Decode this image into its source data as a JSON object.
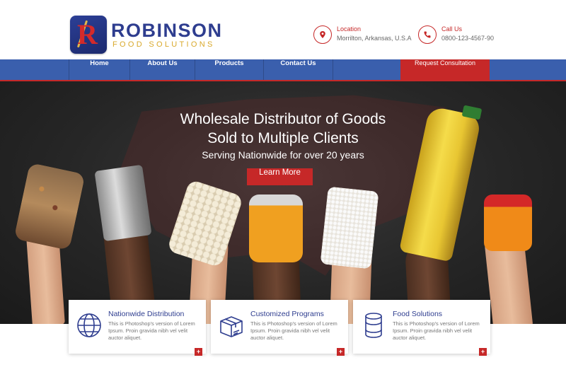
{
  "brand": {
    "name": "ROBINSON",
    "tagline": "FOOD SOLUTIONS",
    "logo_letter": "R"
  },
  "contacts": [
    {
      "label": "Location",
      "value": "Morrilton, Arkansas, U.S.A",
      "icon": "map-pin-icon"
    },
    {
      "label": "Call Us",
      "value": "0800-123-4567-90",
      "icon": "phone-icon"
    }
  ],
  "nav": {
    "items": [
      "Home",
      "About Us",
      "Products",
      "Contact Us"
    ],
    "cta": "Request Consultation"
  },
  "hero": {
    "title_line1": "Wholesale Distributor of Goods",
    "title_line2": "Sold to Multiple Clients",
    "tagline": "Serving Nationwide for over 20 years",
    "button": "Learn More"
  },
  "cards": [
    {
      "title": "Nationwide Distribution",
      "text": "This is Photoshop's version  of Lorem Ipsum. Proin gravida nibh vel velit auctor aliquet.",
      "icon": "globe-icon",
      "more": "+"
    },
    {
      "title": "Customized Programs",
      "text": "This is Photoshop's version  of Lorem Ipsum. Proin gravida nibh vel velit auctor aliquet.",
      "icon": "box-icon",
      "more": "+"
    },
    {
      "title": "Food Solutions",
      "text": "This is Photoshop's version  of Lorem Ipsum. Proin gravida nibh vel velit auctor aliquet.",
      "icon": "can-icon",
      "more": "+"
    }
  ],
  "colors": {
    "brand_blue": "#2e3d8f",
    "nav_blue": "#3a5fad",
    "accent_red": "#c62828",
    "gold": "#d9a92b"
  }
}
